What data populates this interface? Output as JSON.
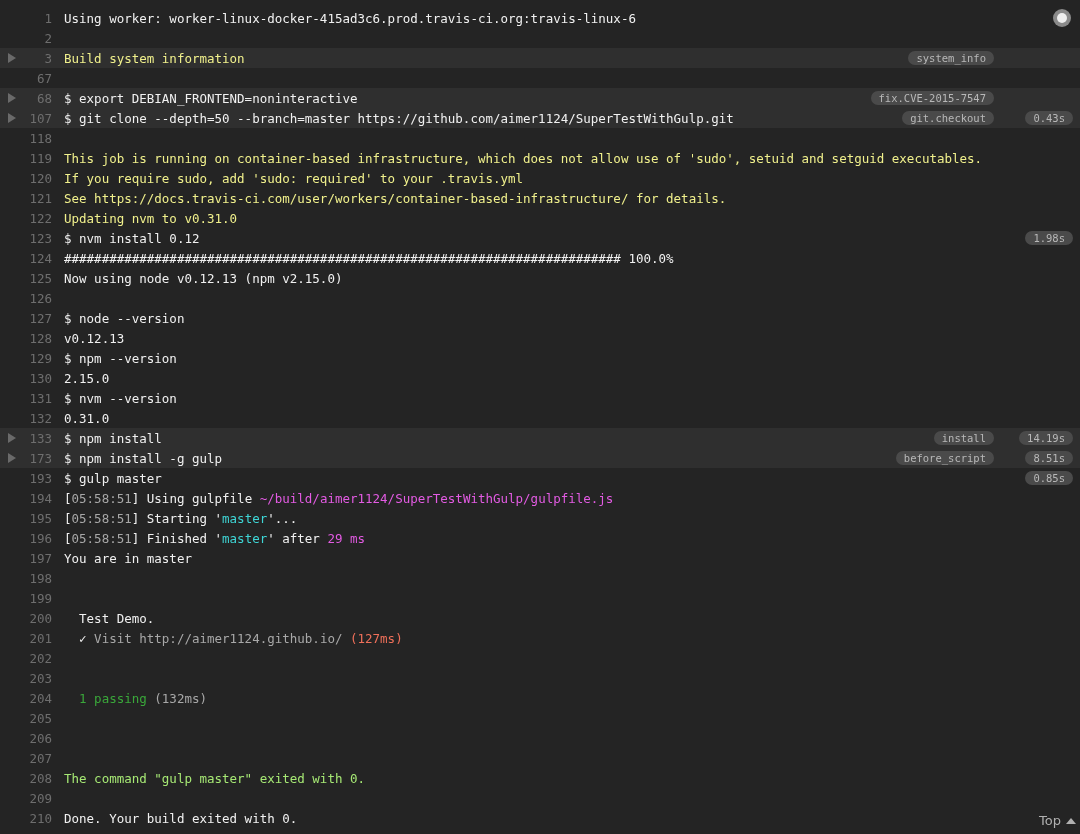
{
  "lines": [
    {
      "num": "1",
      "fold": false,
      "segments": [
        {
          "text": "Using worker: worker-linux-docker-415ad3c6.prod.travis-ci.org:travis-linux-6",
          "kind": "plain"
        }
      ]
    },
    {
      "num": "2",
      "fold": false
    },
    {
      "num": "3",
      "fold": true,
      "tag": "system_info",
      "segments": [
        {
          "text": "Build system information",
          "kind": "yellow"
        }
      ]
    },
    {
      "num": "67",
      "fold": false
    },
    {
      "num": "68",
      "fold": true,
      "tag": "fix.CVE-2015-7547",
      "segments": [
        {
          "text": "$ export DEBIAN_FRONTEND=noninteractive",
          "kind": "plain"
        }
      ]
    },
    {
      "num": "107",
      "fold": true,
      "tag": "git.checkout",
      "time": "0.43s",
      "segments": [
        {
          "text": "$ git clone --depth=50 --branch=master https://github.com/aimer1124/SuperTestWithGulp.git",
          "kind": "plain"
        }
      ]
    },
    {
      "num": "118",
      "fold": false
    },
    {
      "num": "119",
      "fold": false,
      "segments": [
        {
          "text": "This job is running on container-based infrastructure, which does not allow use of 'sudo', setuid and setguid executables.",
          "kind": "yellow"
        }
      ]
    },
    {
      "num": "120",
      "fold": false,
      "segments": [
        {
          "text": "If you require sudo, add 'sudo: required' to your .travis.yml",
          "kind": "yellow"
        }
      ]
    },
    {
      "num": "121",
      "fold": false,
      "segments": [
        {
          "text": "See https://docs.travis-ci.com/user/workers/container-based-infrastructure/ for details.",
          "kind": "yellow"
        }
      ]
    },
    {
      "num": "122",
      "fold": false,
      "segments": [
        {
          "text": "Updating nvm to v0.31.0",
          "kind": "yellow"
        }
      ]
    },
    {
      "num": "123",
      "fold": false,
      "time": "1.98s",
      "segments": [
        {
          "text": "$ nvm install 0.12",
          "kind": "plain"
        }
      ]
    },
    {
      "num": "124",
      "fold": false,
      "segments": [
        {
          "text": "########################################################################## 100.0%",
          "kind": "plain"
        }
      ]
    },
    {
      "num": "125",
      "fold": false,
      "segments": [
        {
          "text": "Now using node v0.12.13 (npm v2.15.0)",
          "kind": "plain"
        }
      ]
    },
    {
      "num": "126",
      "fold": false
    },
    {
      "num": "127",
      "fold": false,
      "segments": [
        {
          "text": "$ node --version",
          "kind": "plain"
        }
      ]
    },
    {
      "num": "128",
      "fold": false,
      "segments": [
        {
          "text": "v0.12.13",
          "kind": "plain"
        }
      ]
    },
    {
      "num": "129",
      "fold": false,
      "segments": [
        {
          "text": "$ npm --version",
          "kind": "plain"
        }
      ]
    },
    {
      "num": "130",
      "fold": false,
      "segments": [
        {
          "text": "2.15.0",
          "kind": "plain"
        }
      ]
    },
    {
      "num": "131",
      "fold": false,
      "segments": [
        {
          "text": "$ nvm --version",
          "kind": "plain"
        }
      ]
    },
    {
      "num": "132",
      "fold": false,
      "segments": [
        {
          "text": "0.31.0",
          "kind": "plain"
        }
      ]
    },
    {
      "num": "133",
      "fold": true,
      "tag": "install",
      "time": "14.19s",
      "segments": [
        {
          "text": "$ npm install",
          "kind": "plain"
        }
      ]
    },
    {
      "num": "173",
      "fold": true,
      "tag": "before_script",
      "time": "8.51s",
      "segments": [
        {
          "text": "$ npm install -g gulp",
          "kind": "plain"
        }
      ]
    },
    {
      "num": "193",
      "fold": false,
      "time": "0.85s",
      "segments": [
        {
          "text": "$ gulp master",
          "kind": "plain"
        }
      ]
    },
    {
      "num": "194",
      "fold": false,
      "segments": [
        {
          "text": "[",
          "kind": "plain"
        },
        {
          "text": "05:58:51",
          "kind": "gray"
        },
        {
          "text": "] Using gulpfile ",
          "kind": "plain"
        },
        {
          "text": "~/build/aimer1124/SuperTestWithGulp/gulpfile.js",
          "kind": "magenta"
        }
      ]
    },
    {
      "num": "195",
      "fold": false,
      "segments": [
        {
          "text": "[",
          "kind": "plain"
        },
        {
          "text": "05:58:51",
          "kind": "gray"
        },
        {
          "text": "] Starting '",
          "kind": "plain"
        },
        {
          "text": "master",
          "kind": "cyan"
        },
        {
          "text": "'...",
          "kind": "plain"
        }
      ]
    },
    {
      "num": "196",
      "fold": false,
      "segments": [
        {
          "text": "[",
          "kind": "plain"
        },
        {
          "text": "05:58:51",
          "kind": "gray"
        },
        {
          "text": "] Finished '",
          "kind": "plain"
        },
        {
          "text": "master",
          "kind": "cyan"
        },
        {
          "text": "' after ",
          "kind": "plain"
        },
        {
          "text": "29 ms",
          "kind": "magenta"
        }
      ]
    },
    {
      "num": "197",
      "fold": false,
      "segments": [
        {
          "text": "You are in master",
          "kind": "plain"
        }
      ]
    },
    {
      "num": "198",
      "fold": false
    },
    {
      "num": "199",
      "fold": false
    },
    {
      "num": "200",
      "fold": false,
      "segments": [
        {
          "text": "  Test Demo.",
          "kind": "plain"
        }
      ]
    },
    {
      "num": "201",
      "fold": false,
      "segments": [
        {
          "text": "  ✓ ",
          "kind": "plain"
        },
        {
          "text": "Visit http://aimer1124.github.io/ ",
          "kind": "gray"
        },
        {
          "text": "(127ms)",
          "kind": "red"
        }
      ]
    },
    {
      "num": "202",
      "fold": false
    },
    {
      "num": "203",
      "fold": false
    },
    {
      "num": "204",
      "fold": false,
      "segments": [
        {
          "text": "  1 passing",
          "kind": "green"
        },
        {
          "text": " (132ms)",
          "kind": "gray"
        }
      ]
    },
    {
      "num": "205",
      "fold": false
    },
    {
      "num": "206",
      "fold": false
    },
    {
      "num": "207",
      "fold": false
    },
    {
      "num": "208",
      "fold": false,
      "segments": [
        {
          "text": "The command \"gulp master\" exited with 0.",
          "kind": "lime"
        }
      ]
    },
    {
      "num": "209",
      "fold": false
    },
    {
      "num": "210",
      "fold": false,
      "segments": [
        {
          "text": "Done. Your build exited with 0.",
          "kind": "plain"
        }
      ]
    }
  ],
  "scroll_top": {
    "label": "Top"
  }
}
